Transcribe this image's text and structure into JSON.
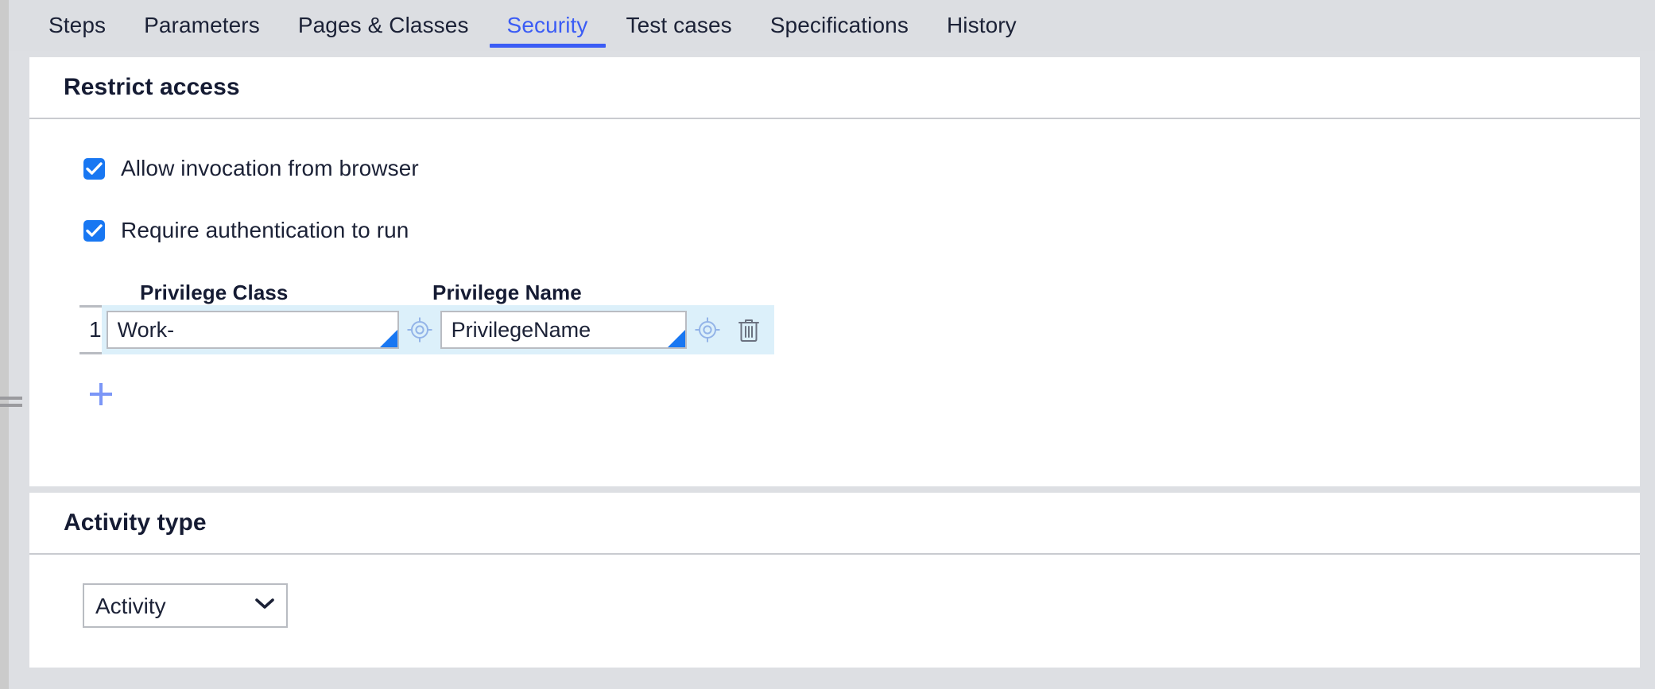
{
  "tabs": [
    {
      "label": "Steps",
      "active": false
    },
    {
      "label": "Parameters",
      "active": false
    },
    {
      "label": "Pages & Classes",
      "active": false
    },
    {
      "label": "Security",
      "active": true
    },
    {
      "label": "Test cases",
      "active": false
    },
    {
      "label": "Specifications",
      "active": false
    },
    {
      "label": "History",
      "active": false
    }
  ],
  "restrict_access": {
    "title": "Restrict access",
    "checkboxes": [
      {
        "label": "Allow invocation from browser",
        "checked": true
      },
      {
        "label": "Require authentication to run",
        "checked": true
      }
    ],
    "table": {
      "columns": [
        "",
        "Privilege Class",
        "Privilege Name"
      ],
      "rows": [
        {
          "index": "1",
          "privilege_class": "Work-",
          "privilege_class_placeholder": "",
          "privilege_name": "PrivilegeName",
          "privilege_name_placeholder": "",
          "class_picker_icon": "crosshair-target-icon",
          "name_picker_icon": "crosshair-target-icon",
          "delete_icon": "trash-icon"
        }
      ]
    },
    "add_row_icon": "plus-icon"
  },
  "activity_type": {
    "title": "Activity type",
    "select": {
      "value": "Activity",
      "options": [
        "Activity"
      ],
      "chevron_icon": "chevron-down-icon"
    }
  },
  "left_rail": {
    "drag_handle_icon": "drag-handle-icon"
  },
  "colors": {
    "accent_blue": "#3b5cf5",
    "checkbox_blue": "#1877f2",
    "row_highlight": "#dcf0fa",
    "page_bg": "#dddfe3",
    "card_bg": "#ffffff",
    "text_dark": "#1b2136",
    "border_gray": "#b9bcc2",
    "plus_blue": "#7b96f7",
    "icon_blue": "#93b4e8"
  }
}
